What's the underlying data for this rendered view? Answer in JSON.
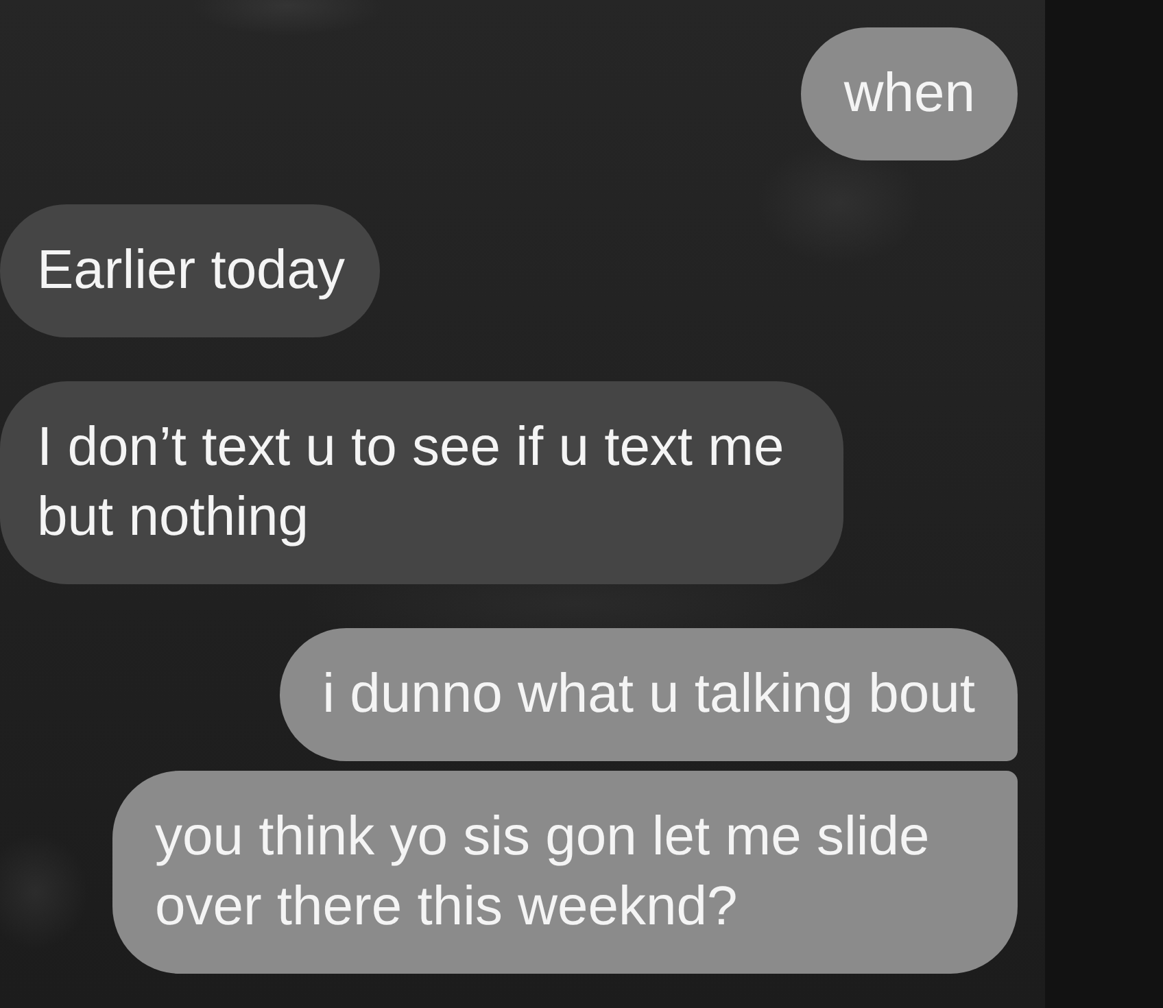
{
  "messages": [
    {
      "kind": "sent",
      "text": "when",
      "grouped_with_next": false
    },
    {
      "kind": "received",
      "text": "Earlier today",
      "grouped_with_next": false
    },
    {
      "kind": "received",
      "text": "I don’t text u to see if u text me but nothing",
      "grouped_with_next": false
    },
    {
      "kind": "sent",
      "text": "i dunno what u talking bout",
      "grouped_with_next": true
    },
    {
      "kind": "sent",
      "text": "you think yo sis gon let me slide over there this weeknd?",
      "grouped_with_next": false
    }
  ]
}
